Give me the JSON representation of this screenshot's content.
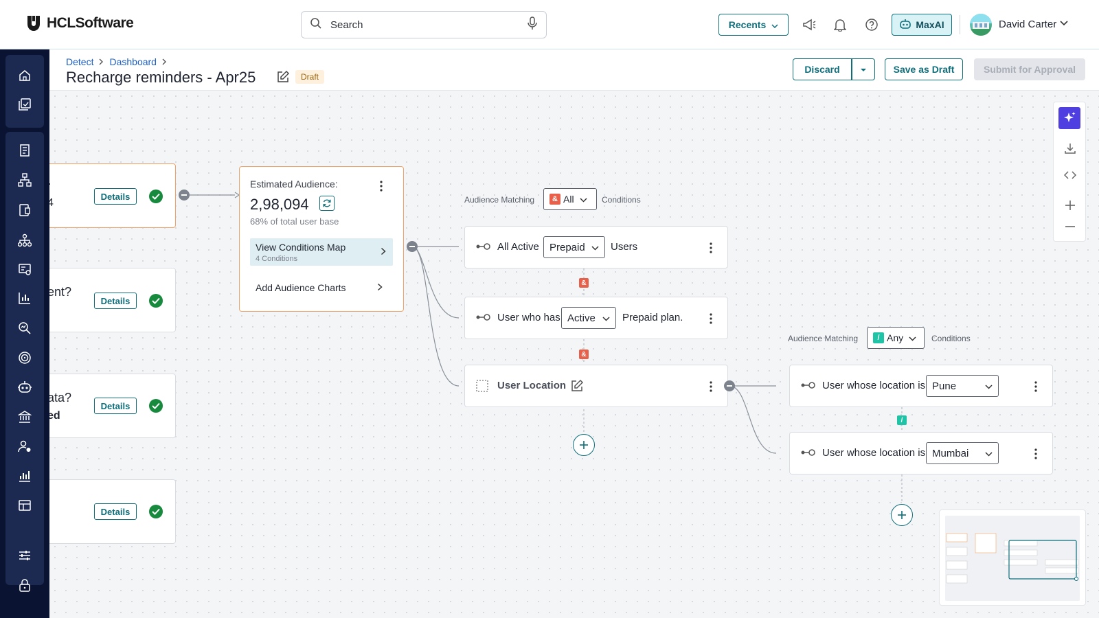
{
  "app": {
    "brand": "HCLSoftware",
    "search_placeholder": "Search",
    "recents_label": "Recents",
    "maxai_label": "MaxAI",
    "user_name": "David Carter"
  },
  "icons": {
    "top": [
      "megaphone-icon",
      "bell-icon",
      "help-icon"
    ],
    "sidebar": [
      "home-icon",
      "portfolio-icon",
      "rules-icon",
      "hierarchy-icon",
      "reports-icon",
      "org-chart-icon",
      "analytics-icon",
      "bar-chart-icon",
      "search-insights-icon",
      "target-icon",
      "bot-icon",
      "bank-icon",
      "user-settings-icon",
      "stats-icon",
      "table-icon",
      "sliders-icon",
      "lock-icon"
    ]
  },
  "header": {
    "breadcrumb": [
      "Detect",
      "Dashboard"
    ],
    "title": "Recharge reminders - Apr25",
    "status": "Draft",
    "discard_label": "Discard",
    "save_draft_label": "Save as Draft",
    "submit_label": "Submit for Approval"
  },
  "left_cards": [
    {
      "line1": "·",
      "line2": "4",
      "details_label": "Details"
    },
    {
      "line1": "ent?",
      "line2": "",
      "details_label": "Details"
    },
    {
      "line1": "ata?",
      "line2": "ed",
      "details_label": "Details"
    },
    {
      "line1": "",
      "line2": "",
      "details_label": "Details"
    }
  ],
  "estimate": {
    "label": "Estimated Audience:",
    "value": "2,98,094",
    "subtitle": "68% of total user base",
    "map_label": "View Conditions Map",
    "map_sub": "4 Conditions",
    "charts_label": "Add Audience Charts"
  },
  "group1": {
    "matching_label": "Audience Matching",
    "operator_symbol": "&",
    "operator_value": "All",
    "conditions_label": "Conditions",
    "conditions": [
      {
        "prefix": "All Active",
        "value": "Prepaid",
        "suffix": "Users"
      },
      {
        "prefix": "User who has",
        "value": "Active",
        "suffix": "Prepaid plan."
      },
      {
        "prefix": "User Location",
        "value": "",
        "suffix": ""
      }
    ]
  },
  "group2": {
    "matching_label": "Audience Matching",
    "operator_symbol": "/",
    "operator_value": "Any",
    "conditions_label": "Conditions",
    "conditions": [
      {
        "prefix": "User whose location is",
        "value": "Pune"
      },
      {
        "prefix": "User whose location is",
        "value": "Mumbai"
      }
    ]
  },
  "colors": {
    "accent": "#0f6e7a",
    "sidebar_bg": "#0b1333",
    "and_operator": "#e8604a",
    "or_operator": "#1fc3a5",
    "ai_button": "#4f3fe0",
    "success": "#178a3e"
  }
}
